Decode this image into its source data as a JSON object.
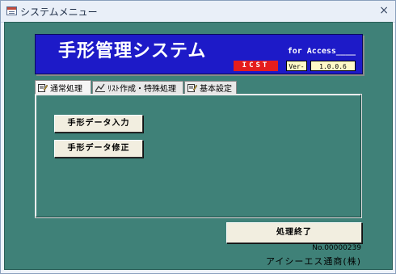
{
  "window": {
    "title": "システムメニュー",
    "close_glyph": "×"
  },
  "banner": {
    "title": "手形管理システム",
    "subtitle": "for Access____",
    "brand": "ICST",
    "version_label": "Ver-",
    "version_value": "1.0.0.6",
    "colors": {
      "background": "#1d1ac8",
      "brand_bg": "#e51d1d",
      "version_bg": "#fff9c8"
    }
  },
  "tabs": [
    {
      "label": "通常処理",
      "icon": "form-edit-icon",
      "active": true
    },
    {
      "label": "ﾘｽﾄ作成・特殊処理",
      "icon": "chart-icon",
      "active": false
    },
    {
      "label": "基本設定",
      "icon": "form-edit-icon",
      "active": false
    }
  ],
  "buttons": {
    "input": "手形データ入力",
    "edit": "手形データ修正",
    "exit": "処理終了"
  },
  "footer": {
    "doc_no": "No.00000239",
    "company": "アイシーエス通商(株)"
  },
  "colors": {
    "client_bg": "#3f8178"
  }
}
